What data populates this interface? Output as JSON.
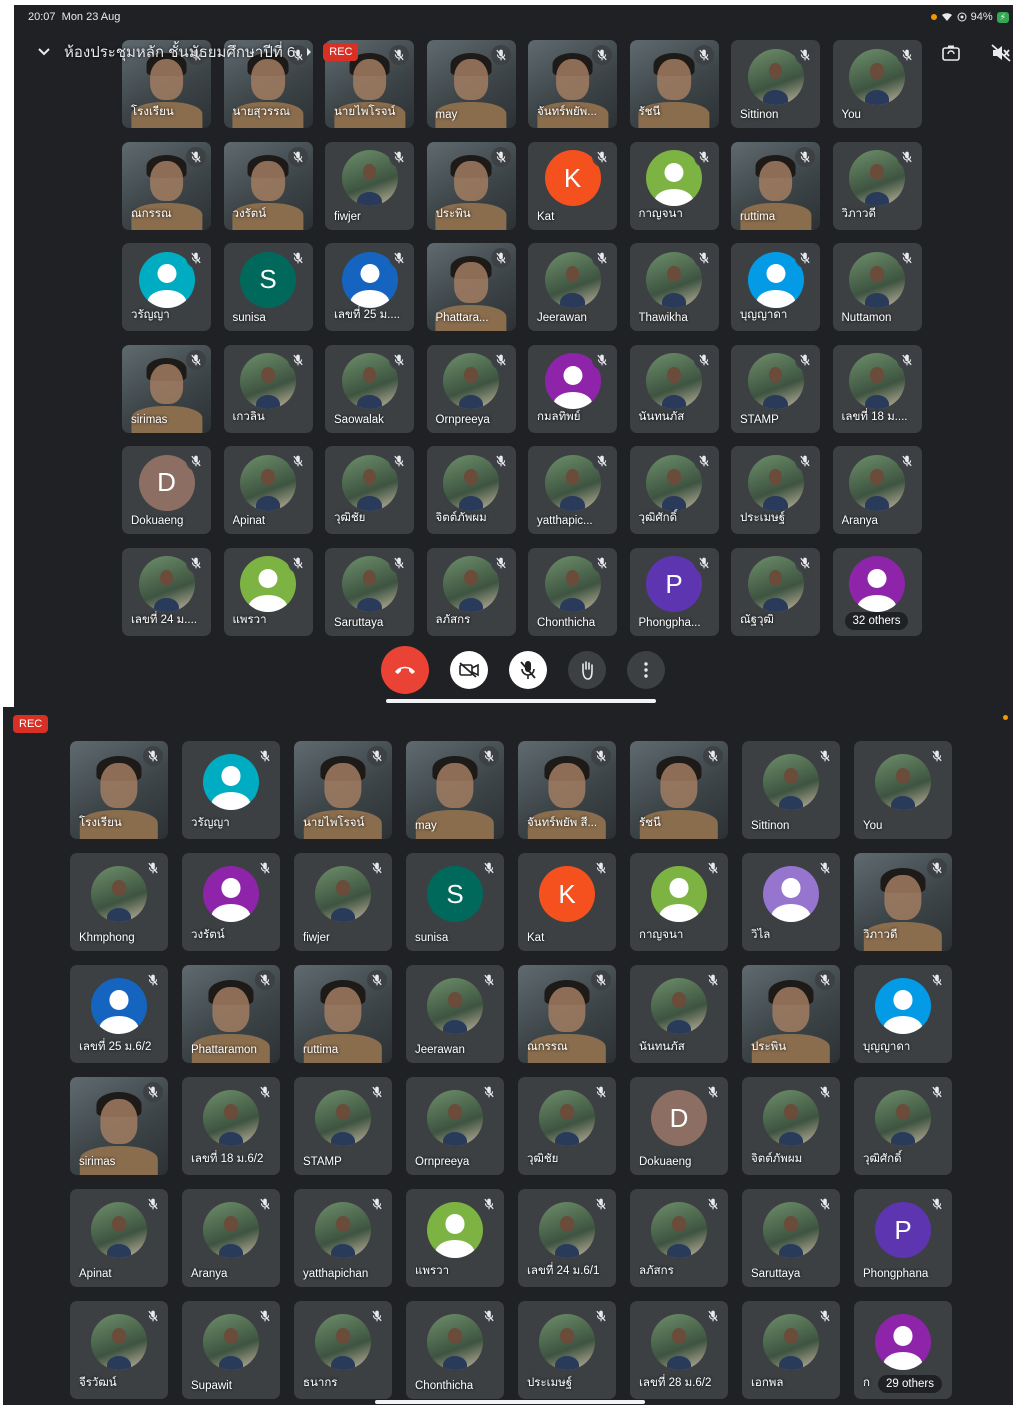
{
  "status_bar": {
    "time": "20:07",
    "date": "Mon 23 Aug",
    "battery": "94%"
  },
  "meeting": {
    "title": "ห้องประชุมหลัก ชั้นมัธยมศึกษาปีที่ 6",
    "rec_label": "REC"
  },
  "icons": {
    "back": "chevron-down-icon",
    "chevron_right": "chevron-right-icon",
    "flip_camera": "flip-camera-icon",
    "speaker_off": "speaker-off-icon",
    "mic_muted": "mic-off-icon"
  },
  "colors": {
    "background": "#202124",
    "tile": "#3c4043",
    "rec": "#d93025",
    "hangup": "#ea4335"
  },
  "controls": {
    "hangup": "phone-hangup-icon",
    "camera": "camera-off-icon",
    "mic": "mic-off-icon",
    "hand": "raise-hand-icon",
    "more": "more-vert-icon"
  },
  "top_grid": {
    "participants": [
      {
        "name": "โรงเรียน",
        "kind": "video"
      },
      {
        "name": "นายสุวรรณ",
        "kind": "video"
      },
      {
        "name": "นายไพโรจน์",
        "kind": "video"
      },
      {
        "name": "may",
        "kind": "video"
      },
      {
        "name": "จันทร์พยัพ...",
        "kind": "video"
      },
      {
        "name": "รัชนี",
        "kind": "video"
      },
      {
        "name": "Sittinon",
        "kind": "photo"
      },
      {
        "name": "You",
        "kind": "photo"
      },
      {
        "name": "ณกรรณ",
        "kind": "video"
      },
      {
        "name": "วงรัตน์",
        "kind": "video"
      },
      {
        "name": "fiwjer",
        "kind": "photo"
      },
      {
        "name": "ประพิน",
        "kind": "video"
      },
      {
        "name": "Kat",
        "kind": "letter",
        "letter": "K",
        "color": "#f4511e"
      },
      {
        "name": "กาญจนา",
        "kind": "person",
        "color": "#7cb342"
      },
      {
        "name": "ruttima",
        "kind": "video"
      },
      {
        "name": "วิภาวดี",
        "kind": "photo"
      },
      {
        "name": "วรัญญา",
        "kind": "person",
        "color": "#00acc1"
      },
      {
        "name": "sunisa",
        "kind": "letter",
        "letter": "S",
        "color": "#00695c"
      },
      {
        "name": "เลขที่ 25 ม....",
        "kind": "person",
        "color": "#1565c0"
      },
      {
        "name": "Phattara...",
        "kind": "video"
      },
      {
        "name": "Jeerawan",
        "kind": "photo"
      },
      {
        "name": "Thawikha",
        "kind": "photo"
      },
      {
        "name": "บุญญาดา",
        "kind": "person",
        "color": "#039be5"
      },
      {
        "name": "Nuttamon",
        "kind": "photo"
      },
      {
        "name": "sirimas",
        "kind": "video"
      },
      {
        "name": "เกวลิน",
        "kind": "photo"
      },
      {
        "name": "Saowalak",
        "kind": "photo"
      },
      {
        "name": "Ornpreeya",
        "kind": "photo"
      },
      {
        "name": "กมลทิพย์",
        "kind": "person",
        "color": "#8e24aa"
      },
      {
        "name": "นันทนภัส",
        "kind": "photo"
      },
      {
        "name": "STAMP",
        "kind": "photo"
      },
      {
        "name": "เลขที่ 18 ม....",
        "kind": "photo"
      },
      {
        "name": "Dokuaeng",
        "kind": "letter",
        "letter": "D",
        "color": "#8d6e63"
      },
      {
        "name": "Apinat",
        "kind": "photo"
      },
      {
        "name": "วุฒิชัย",
        "kind": "photo"
      },
      {
        "name": "จิตต์ภัพผม",
        "kind": "photo"
      },
      {
        "name": "yatthapic...",
        "kind": "photo"
      },
      {
        "name": "วุฒิศักดิ์",
        "kind": "photo"
      },
      {
        "name": "ประเมษฐ์",
        "kind": "photo"
      },
      {
        "name": "Aranya",
        "kind": "photo"
      },
      {
        "name": "เลขที่ 24 ม....",
        "kind": "photo"
      },
      {
        "name": "แพรวา",
        "kind": "person",
        "color": "#7cb342"
      },
      {
        "name": "Saruttaya",
        "kind": "photo"
      },
      {
        "name": "ลภัสกร",
        "kind": "photo"
      },
      {
        "name": "Chonthicha",
        "kind": "photo"
      },
      {
        "name": "Phongpha...",
        "kind": "letter",
        "letter": "P",
        "color": "#5e35b1"
      },
      {
        "name": "ณัฐวุฒิ",
        "kind": "photo"
      },
      {
        "name": "32 others",
        "kind": "others",
        "color": "#8e24aa"
      }
    ]
  },
  "bottom_grid": {
    "rec_label": "REC",
    "participants": [
      {
        "name": "โรงเรียน",
        "kind": "video"
      },
      {
        "name": "วรัญญา",
        "kind": "person",
        "color": "#00acc1"
      },
      {
        "name": "นายไพโรจน์",
        "kind": "video"
      },
      {
        "name": "may",
        "kind": "video"
      },
      {
        "name": "จันทร์พยัพ สี...",
        "kind": "video"
      },
      {
        "name": "รัชนี",
        "kind": "video"
      },
      {
        "name": "Sittinon",
        "kind": "photo"
      },
      {
        "name": "You",
        "kind": "photo"
      },
      {
        "name": "Khmphong",
        "kind": "photo"
      },
      {
        "name": "วงรัตน์",
        "kind": "person",
        "color": "#8e24aa"
      },
      {
        "name": "fiwjer",
        "kind": "photo"
      },
      {
        "name": "sunisa",
        "kind": "letter",
        "letter": "S",
        "color": "#00695c"
      },
      {
        "name": "Kat",
        "kind": "letter",
        "letter": "K",
        "color": "#f4511e"
      },
      {
        "name": "กาญจนา",
        "kind": "person",
        "color": "#7cb342"
      },
      {
        "name": "วิไล",
        "kind": "person",
        "color": "#9575cd"
      },
      {
        "name": "วิภาวดี",
        "kind": "video"
      },
      {
        "name": "เลขที่ 25 ม.6/2",
        "kind": "person",
        "color": "#1565c0"
      },
      {
        "name": "Phattaramon",
        "kind": "video"
      },
      {
        "name": "ruttima",
        "kind": "video"
      },
      {
        "name": "Jeerawan",
        "kind": "photo"
      },
      {
        "name": "ณกรรณ",
        "kind": "video"
      },
      {
        "name": "นันทนภัส",
        "kind": "photo"
      },
      {
        "name": "ประพิน",
        "kind": "video"
      },
      {
        "name": "บุญญาดา",
        "kind": "person",
        "color": "#039be5"
      },
      {
        "name": "sirimas",
        "kind": "video"
      },
      {
        "name": "เลขที่ 18 ม.6/2",
        "kind": "photo"
      },
      {
        "name": "STAMP",
        "kind": "photo"
      },
      {
        "name": "Ornpreeya",
        "kind": "photo"
      },
      {
        "name": "วุฒิชัย",
        "kind": "photo"
      },
      {
        "name": "Dokuaeng",
        "kind": "letter",
        "letter": "D",
        "color": "#8d6e63"
      },
      {
        "name": "จิตต์ภัพผม",
        "kind": "photo"
      },
      {
        "name": "วุฒิศักดิ์",
        "kind": "photo"
      },
      {
        "name": "Apinat",
        "kind": "photo"
      },
      {
        "name": "Aranya",
        "kind": "photo"
      },
      {
        "name": "yatthapichan",
        "kind": "photo"
      },
      {
        "name": "แพรวา",
        "kind": "person",
        "color": "#7cb342"
      },
      {
        "name": "เลขที่ 24 ม.6/1",
        "kind": "photo"
      },
      {
        "name": "ลภัสกร",
        "kind": "photo"
      },
      {
        "name": "Saruttaya",
        "kind": "photo"
      },
      {
        "name": "Phongphana",
        "kind": "letter",
        "letter": "P",
        "color": "#5e35b1"
      },
      {
        "name": "จีรวัฒน์",
        "kind": "photo"
      },
      {
        "name": "Supawit",
        "kind": "photo"
      },
      {
        "name": "ธนากร",
        "kind": "photo"
      },
      {
        "name": "Chonthicha",
        "kind": "photo"
      },
      {
        "name": "ประเมษฐ์",
        "kind": "photo"
      },
      {
        "name": "เลขที่ 28 ม.6/2",
        "kind": "photo"
      },
      {
        "name": "เอกพล",
        "kind": "photo"
      },
      {
        "name": "29 others",
        "kind": "others",
        "color": "#8e24aa",
        "prefix": "ก"
      }
    ]
  }
}
